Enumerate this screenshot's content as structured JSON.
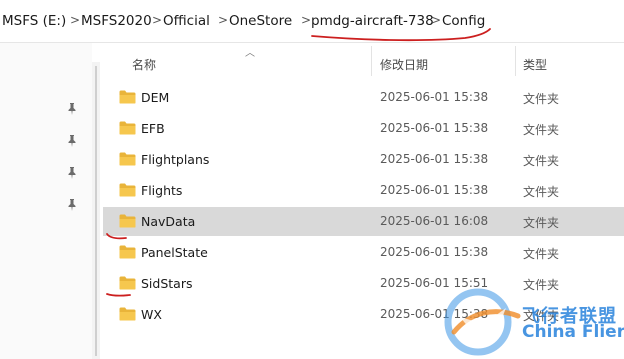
{
  "breadcrumb": {
    "items": [
      {
        "label": "MSFS (E:)"
      },
      {
        "label": "MSFS2020"
      },
      {
        "label": "Official"
      },
      {
        "label": "OneStore"
      },
      {
        "label": "pmdg-aircraft-738"
      },
      {
        "label": "Config"
      }
    ],
    "separator": ">"
  },
  "columns": {
    "name": "名称",
    "modified": "修改日期",
    "type": "类型"
  },
  "files": [
    {
      "name": "DEM",
      "modified": "2025-06-01 15:38",
      "type": "文件夹",
      "selected": false
    },
    {
      "name": "EFB",
      "modified": "2025-06-01 15:38",
      "type": "文件夹",
      "selected": false
    },
    {
      "name": "Flightplans",
      "modified": "2025-06-01 15:38",
      "type": "文件夹",
      "selected": false
    },
    {
      "name": "Flights",
      "modified": "2025-06-01 15:38",
      "type": "文件夹",
      "selected": false
    },
    {
      "name": "NavData",
      "modified": "2025-06-01 16:08",
      "type": "文件夹",
      "selected": true
    },
    {
      "name": "PanelState",
      "modified": "2025-06-01 15:38",
      "type": "文件夹",
      "selected": false
    },
    {
      "name": "SidStars",
      "modified": "2025-06-01 15:51",
      "type": "文件夹",
      "selected": false
    },
    {
      "name": "WX",
      "modified": "2025-06-01 15:38",
      "type": "文件夹",
      "selected": false
    }
  ],
  "icons": {
    "folder": "folder-icon",
    "pin": "pin-icon",
    "sort": "sort-ascending-icon"
  },
  "colors": {
    "folder": "#f6c74e",
    "selection": "#d9d9d9",
    "annotation": "#cc1f1f"
  },
  "watermark": {
    "cn": "飞行者联盟",
    "en": "China Flier"
  }
}
